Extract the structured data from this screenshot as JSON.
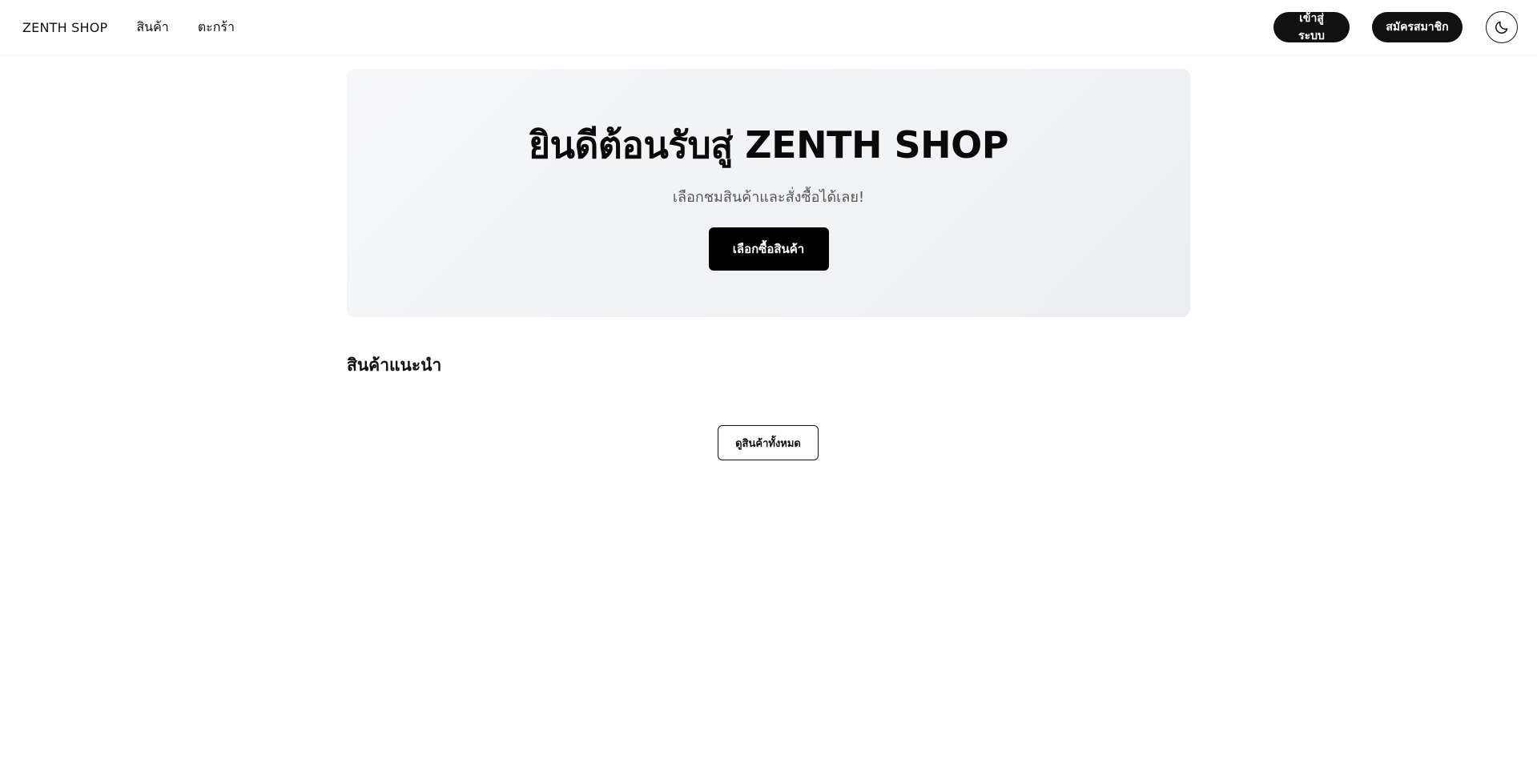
{
  "navbar": {
    "brand": "ZENTH SHOP",
    "links": [
      "สินค้า",
      "ตะกร้า"
    ],
    "login_label": "เข้าสู่ระบบ",
    "register_label": "สมัครสมาชิก",
    "theme_toggle_icon": "moon-icon"
  },
  "hero": {
    "title": "ยินดีต้อนรับสู่ ZENTH SHOP",
    "subtitle": "เลือกชมสินค้าและสั่งซื้อได้เลย!",
    "cta_label": "เลือกซื้อสินค้า"
  },
  "featured": {
    "title": "สินค้าแนะนำ",
    "view_all_label": "ดูสินค้าทั้งหมด"
  },
  "colors": {
    "primary": "#111111",
    "background": "#ffffff",
    "hero_bg": "#f1f2f4"
  }
}
